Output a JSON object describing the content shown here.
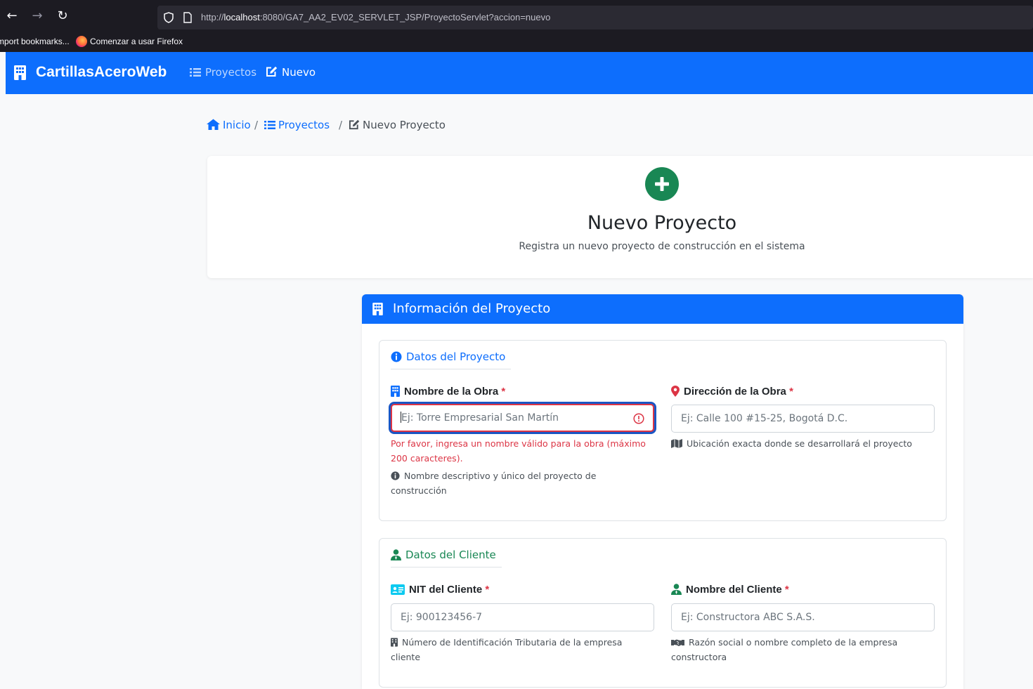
{
  "browser": {
    "url_prefix": "http://",
    "url_host": "localhost",
    "url_rest": ":8080/GA7_AA2_EV02_SERVLET_JSP/ProyectoServlet?accion=nuevo",
    "bookmarks": [
      "mport bookmarks...",
      "Comenzar a usar Firefox"
    ]
  },
  "navbar": {
    "brand": "CartillasAceroWeb",
    "links": [
      {
        "label": "Proyectos",
        "icon": "list-icon",
        "active": false
      },
      {
        "label": "Nuevo",
        "icon": "edit-icon",
        "active": true
      }
    ]
  },
  "breadcrumb": {
    "home": "Inicio",
    "projects": "Proyectos",
    "current": "Nuevo Proyecto",
    "separator": "/"
  },
  "header": {
    "title": "Nuevo Proyecto",
    "subtitle": "Registra un nuevo proyecto de construcción en el sistema"
  },
  "form": {
    "card_title": "Información del Proyecto",
    "required_mark": "*",
    "project_section": {
      "legend": "Datos del Proyecto",
      "obra_name": {
        "label": "Nombre de la Obra",
        "placeholder": "Ej: Torre Empresarial San Martín",
        "error": "Por favor, ingresa un nombre válido para la obra (máximo 200 caracteres).",
        "help": "Nombre descriptivo y único del proyecto de construcción"
      },
      "obra_address": {
        "label": "Dirección de la Obra",
        "placeholder": "Ej: Calle 100 #15-25, Bogotá D.C.",
        "help": "Ubicación exacta donde se desarrollará el proyecto"
      }
    },
    "client_section": {
      "legend": "Datos del Cliente",
      "nit": {
        "label": "NIT del Cliente",
        "placeholder": "Ej: 900123456-7",
        "help": "Número de Identificación Tributaria de la empresa cliente"
      },
      "client_name": {
        "label": "Nombre del Cliente",
        "placeholder": "Ej: Constructora ABC S.A.S.",
        "help": "Razón social o nombre completo de la empresa constructora"
      }
    }
  },
  "colors": {
    "primary": "#0d6efd",
    "success": "#198754",
    "danger": "#dc3545",
    "info": "#0dcaf0"
  }
}
